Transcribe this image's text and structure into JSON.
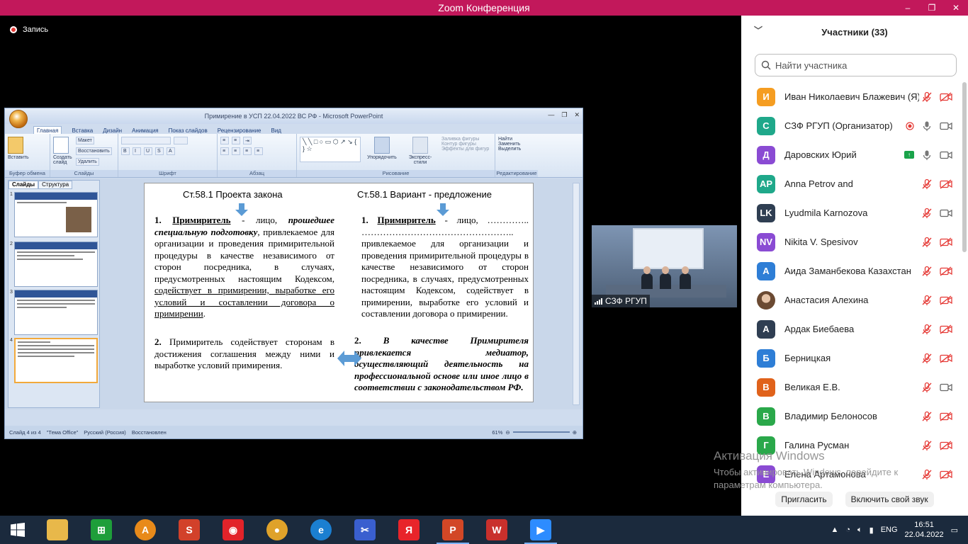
{
  "window": {
    "title": "Zoom Конференция",
    "minimize": "–",
    "restore": "❐",
    "close": "✕"
  },
  "recording": {
    "label": "Запись"
  },
  "ppt": {
    "title": "Примирение в УСП 22.04.2022 ВС РФ - Microsoft PowerPoint",
    "tabs": [
      "Главная",
      "Вставка",
      "Дизайн",
      "Анимация",
      "Показ слайдов",
      "Рецензирование",
      "Вид"
    ],
    "groups": [
      "Буфер обмена",
      "Слайды",
      "Шрифт",
      "Абзац",
      "Рисование",
      "Редактирование"
    ],
    "buttons": {
      "paste": "Вставить",
      "create_slide": "Создать слайд",
      "layout": "Макет",
      "reset": "Восстановить",
      "delete": "Удалить",
      "arrange": "Упорядочить",
      "quick_styles": "Экспресс-стили",
      "fill": "Заливка фигуры",
      "outline": "Контур фигуры",
      "effects": "Эффекты для фигур",
      "find": "Найти",
      "replace": "Заменить",
      "select": "Выделить"
    },
    "panel_tabs": [
      "Слайды",
      "Структура"
    ],
    "thumb_numbers": [
      "1",
      "2",
      "3",
      "4"
    ],
    "status": {
      "slide": "Слайд 4 из 4",
      "theme": "\"Тема Office\"",
      "lang": "Русский (Россия)",
      "state": "Восстановлен",
      "zoom": "61%"
    },
    "slide": {
      "left_heading": "Ст.58.1 Проекта закона",
      "right_heading": "Ст.58.1    Вариант - предложение",
      "left_p1_num": "1.",
      "left_p1_term": "Примиритель",
      "left_p1_mid": " - лицо, ",
      "left_p1_em": "прошедшее специальную подготовку",
      "left_p1_rest": ", привлекаемое для организации и проведения примирительной процедуры в качестве независимого от сторон посредника, в случаях, предусмотренных настоящим Кодексом, ",
      "left_p1_underline": "содействует в примирении, выработке его условий и составлении договора о примирении",
      "left_p1_end": ".",
      "left_p2_num": "2.",
      "left_p2": "Примиритель содействует сторонам в достижения соглашения между ними и выработке условий примирения.",
      "right_p1_num": "1.",
      "right_p1_term": "Примиритель",
      "right_p1_rest": " - лицо, ………….. ………………………………………….. привлекаемое для организации и проведения примирительной процедуры в качестве независимого от сторон посредника, в случаях, предусмотренных настоящим Кодексом, содействует в примирении, выработке его условий и составлении договора о примирении.",
      "right_p2_num": "2.",
      "right_p2": "В качестве Примирителя привлекается медиатор, осуществляющий деятельность на профессиональной основе или иное лицо в соответствии с законодательством РФ."
    }
  },
  "video": {
    "label": "СЗФ РГУП"
  },
  "participants": {
    "header": "Участники (33)",
    "search_placeholder": "Найти участника",
    "items": [
      {
        "initials": "И",
        "name": "Иван Николаевич Блажевич (Я)",
        "color": "#f59d21",
        "mic": "off",
        "cam": "off"
      },
      {
        "initials": "С",
        "name": "СЗФ РГУП (Организатор)",
        "color": "#1fa88a",
        "mic": "on",
        "cam": "on",
        "rec": true
      },
      {
        "initials": "Д",
        "name": "Даровских Юрий",
        "color": "#8a4bd3",
        "mic": "on",
        "cam": "on",
        "share": true
      },
      {
        "initials": "AP",
        "name": "Anna Petrov and",
        "color": "#1fa88a",
        "mic": "off",
        "cam": "off"
      },
      {
        "initials": "LK",
        "name": "Lyudmila Karnozova",
        "color": "#2f3e52",
        "mic": "off",
        "cam": "on"
      },
      {
        "initials": "NV",
        "name": "Nikita V. Spesivov",
        "color": "#8a4bd3",
        "mic": "off",
        "cam": "off"
      },
      {
        "initials": "А",
        "name": "Аида Заманбекова Казахстан",
        "color": "#2e7ed6",
        "mic": "off",
        "cam": "off"
      },
      {
        "initials": "",
        "name": "Анастасия Алехина",
        "color": "#b08060",
        "mic": "off",
        "cam": "off",
        "photo": true
      },
      {
        "initials": "А",
        "name": "Ардак Биебаева",
        "color": "#2f3e52",
        "mic": "off",
        "cam": "off"
      },
      {
        "initials": "Б",
        "name": "Берницкая",
        "color": "#2e7ed6",
        "mic": "off",
        "cam": "off"
      },
      {
        "initials": "В",
        "name": "Великая Е.В.",
        "color": "#e0621b",
        "mic": "off",
        "cam": "on"
      },
      {
        "initials": "В",
        "name": "Владимир Белоносов",
        "color": "#2aa84a",
        "mic": "off",
        "cam": "off"
      },
      {
        "initials": "Г",
        "name": "Галина Русман",
        "color": "#2aa84a",
        "mic": "off",
        "cam": "off"
      },
      {
        "initials": "Е",
        "name": "Елена Артамонова",
        "color": "#8a4bd3",
        "mic": "off",
        "cam": "off"
      }
    ],
    "invite": "Пригласить",
    "unmute": "Включить свой звук"
  },
  "watermark": {
    "line1": "Активация Windows",
    "line2": "Чтобы активировать Windows, перейдите к",
    "line3": "параметрам компьютера."
  },
  "taskbar": {
    "apps": [
      {
        "name": "explorer",
        "color": "#e8b84a",
        "glyph": "",
        "active": false
      },
      {
        "name": "store",
        "color": "#1e9e3a",
        "glyph": "⊞",
        "active": false
      },
      {
        "name": "app-a",
        "color": "#e88a1a",
        "glyph": "A",
        "active": false
      },
      {
        "name": "suite2",
        "color": "#d2412a",
        "glyph": "S",
        "active": false
      },
      {
        "name": "app-red",
        "color": "#e2232a",
        "glyph": "◉",
        "active": false
      },
      {
        "name": "chrome",
        "color": "#dfa22a",
        "glyph": "●",
        "active": false
      },
      {
        "name": "edge",
        "color": "#1b7fd1",
        "glyph": "e",
        "active": false
      },
      {
        "name": "snip",
        "color": "#3a5fcf",
        "glyph": "✂",
        "active": false
      },
      {
        "name": "yandex",
        "color": "#e8242a",
        "glyph": "Я",
        "active": false
      },
      {
        "name": "powerpoint",
        "color": "#d24726",
        "glyph": "P",
        "active": true
      },
      {
        "name": "pdf",
        "color": "#c9302c",
        "glyph": "W",
        "active": false
      },
      {
        "name": "zoom",
        "color": "#2d8cff",
        "glyph": "▶",
        "active": true
      }
    ],
    "lang": "ENG",
    "time": "16:51",
    "date": "22.04.2022"
  }
}
